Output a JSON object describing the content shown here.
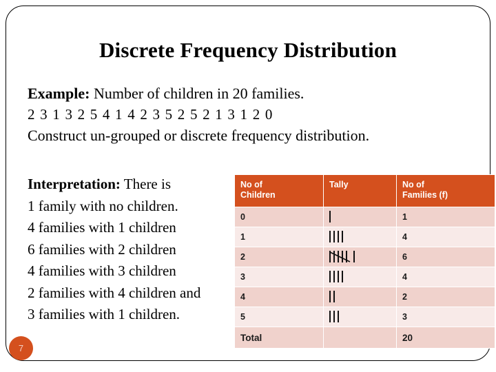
{
  "slide": {
    "title": "Discrete Frequency Distribution",
    "page_number": "7",
    "accent_color": "#d4501e",
    "row_dark_color": "#f0d2cc",
    "row_light_color": "#f8eae8"
  },
  "example": {
    "label": "Example:",
    "statement": " Number of children in 20 families.",
    "data_sequence": "2 3 1 3 2 5 4 1 4 2 3 5 2 5 2 1 3 1 2 0",
    "instruction": "Construct un-grouped or discrete frequency distribution."
  },
  "interpretation": {
    "label": "Interpretation:",
    "lead": " There is",
    "lines": [
      "1 family with no children.",
      "4 families with 1 children",
      "6 families with 2 children",
      "4 families with 3 children",
      "2 families with 4 children and",
      "3 families with 1 children."
    ]
  },
  "table": {
    "headers": [
      "No of Children",
      "Tally",
      "No of Families (f)"
    ],
    "header_lines": [
      [
        "No of",
        "Children"
      ],
      [
        "Tally",
        ""
      ],
      [
        "No of",
        "Families (f)"
      ]
    ],
    "rows": [
      {
        "children": "0",
        "tally_count": 1,
        "families": "1"
      },
      {
        "children": "1",
        "tally_count": 4,
        "families": "4"
      },
      {
        "children": "2",
        "tally_count": 6,
        "families": "6"
      },
      {
        "children": "3",
        "tally_count": 4,
        "families": "4"
      },
      {
        "children": "4",
        "tally_count": 2,
        "families": "2"
      },
      {
        "children": "5",
        "tally_count": 3,
        "families": "3"
      }
    ],
    "total_label": "Total",
    "total_tally": "",
    "total_families": "20"
  },
  "chart_data": {
    "type": "table",
    "title": "Discrete Frequency Distribution",
    "categories": [
      "0",
      "1",
      "2",
      "3",
      "4",
      "5"
    ],
    "values": [
      1,
      4,
      6,
      4,
      2,
      3
    ],
    "xlabel": "No of Children",
    "ylabel": "No of Families (f)",
    "total": 20,
    "raw_observations": [
      2,
      3,
      1,
      3,
      2,
      5,
      4,
      1,
      4,
      2,
      3,
      5,
      2,
      5,
      2,
      1,
      3,
      1,
      2,
      0
    ]
  }
}
